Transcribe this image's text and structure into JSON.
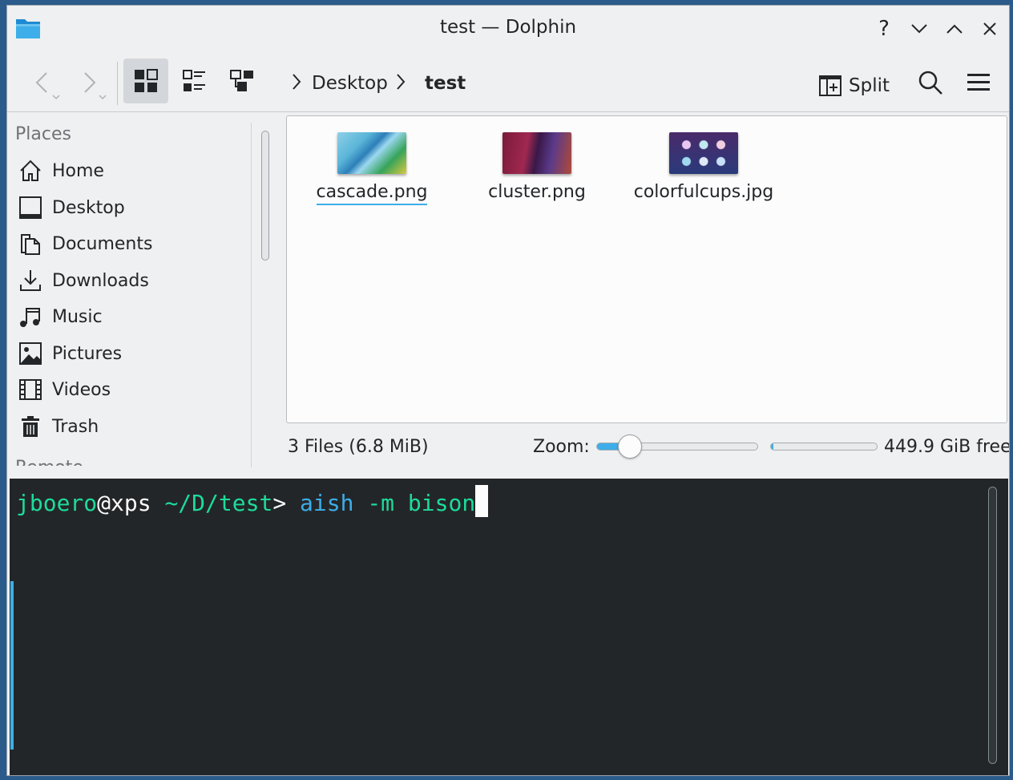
{
  "window": {
    "title": "test — Dolphin"
  },
  "title_buttons": {
    "help": "?",
    "minimize": "minimize",
    "maximize": "maximize",
    "close": "close"
  },
  "toolbar": {
    "split_label": "Split"
  },
  "breadcrumb": {
    "items": [
      "Desktop",
      "test"
    ]
  },
  "places": {
    "header": "Places",
    "items": [
      {
        "label": "Home",
        "icon": "home-icon"
      },
      {
        "label": "Desktop",
        "icon": "desktop-icon"
      },
      {
        "label": "Documents",
        "icon": "documents-icon"
      },
      {
        "label": "Downloads",
        "icon": "downloads-icon"
      },
      {
        "label": "Music",
        "icon": "music-icon"
      },
      {
        "label": "Pictures",
        "icon": "pictures-icon"
      },
      {
        "label": "Videos",
        "icon": "videos-icon"
      },
      {
        "label": "Trash",
        "icon": "trash-icon"
      }
    ],
    "next_header_partial": "Remote"
  },
  "files": [
    {
      "name": "cascade.png",
      "selected": true
    },
    {
      "name": "cluster.png",
      "selected": false
    },
    {
      "name": "colorfulcups.jpg",
      "selected": false
    }
  ],
  "statusbar": {
    "summary": "3 Files (6.8 MiB)",
    "zoom_label": "Zoom:",
    "zoom_level_fraction": 0.18,
    "free_space": "449.9 GiB free",
    "disk_used_fraction": 0.02
  },
  "terminal": {
    "user": "jboero",
    "at": "@",
    "host": "xps",
    "path": " ~/D/test",
    "prompt": "> ",
    "command": "aish",
    "args": " -m bison"
  },
  "colors": {
    "accent": "#3daee9",
    "terminal_bg": "#232629",
    "terminal_green": "#1cdc9a"
  }
}
